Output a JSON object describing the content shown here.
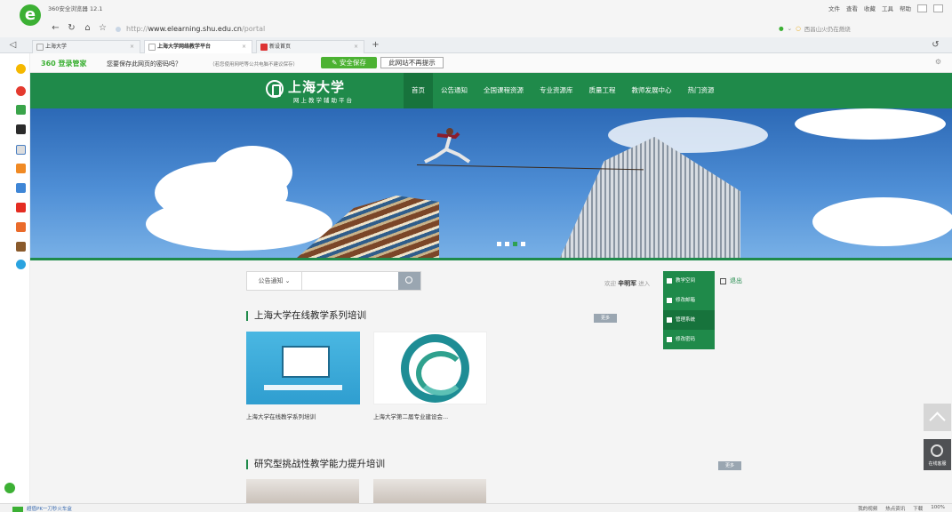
{
  "browser": {
    "window_title": "360安全浏览器 12.1",
    "menu": [
      "文件",
      "查看",
      "收藏",
      "工具",
      "帮助"
    ],
    "url": {
      "scheme": "http://",
      "host": "www.elearning.shu.edu.cn",
      "path": "/portal"
    },
    "search_hint": "西昌山火仍在燃烧",
    "tabs": [
      {
        "label": "上海大学",
        "active": false
      },
      {
        "label": "上海大学网络教学平台",
        "active": true
      },
      {
        "label": "新设首页",
        "active": false
      }
    ],
    "new_tab": "+"
  },
  "password_bar": {
    "brand": "360 登录管家",
    "question": "您要保存此网页的密码吗？",
    "note": "（若您使用网吧等公共电脑不建议保存）",
    "save_label": "安全保存",
    "no_label": "此网站不再提示"
  },
  "site": {
    "name": "上海大学",
    "subtitle": "网上教学辅助平台",
    "nav": [
      {
        "label": "首页",
        "active": true
      },
      {
        "label": "公告通知",
        "active": false
      },
      {
        "label": "全国课程资源",
        "active": false
      },
      {
        "label": "专业资源库",
        "active": false
      },
      {
        "label": "质量工程",
        "active": false
      },
      {
        "label": "教师发展中心",
        "active": false
      },
      {
        "label": "热门资源",
        "active": false
      }
    ]
  },
  "banner": {
    "slides": 4,
    "active_slide": 3
  },
  "search": {
    "category": "公告通知 ⌄"
  },
  "user": {
    "welcome": "欢迎",
    "name": "辛明军",
    "enter": "进入",
    "logout": "退出",
    "menu": [
      {
        "label": "教学空间",
        "icon": "home-icon"
      },
      {
        "label": "修改邮箱",
        "icon": "mail-icon"
      },
      {
        "label": "管理系统",
        "icon": "tools-icon",
        "highlighted": true
      },
      {
        "label": "修改密码",
        "icon": "tools-icon"
      }
    ]
  },
  "sections": [
    {
      "title": "上海大学在线教学系列培训",
      "more": "更多",
      "cards": [
        {
          "caption": "上海大学在线教学系列培训"
        },
        {
          "caption": "上海大学第二届专业建设会..."
        }
      ]
    },
    {
      "title": "研究型挑战性教学能力提升培训",
      "more": "更多"
    }
  ],
  "widgets": {
    "service_label": "在线客服"
  },
  "status": {
    "left_link": "超值PK一刀秒火车盒",
    "right_items": [
      "我的视频",
      "热点资讯",
      "下载",
      "100%"
    ]
  },
  "colors": {
    "primary_green": "#1f8a4a",
    "browser_green": "#3cb034"
  }
}
